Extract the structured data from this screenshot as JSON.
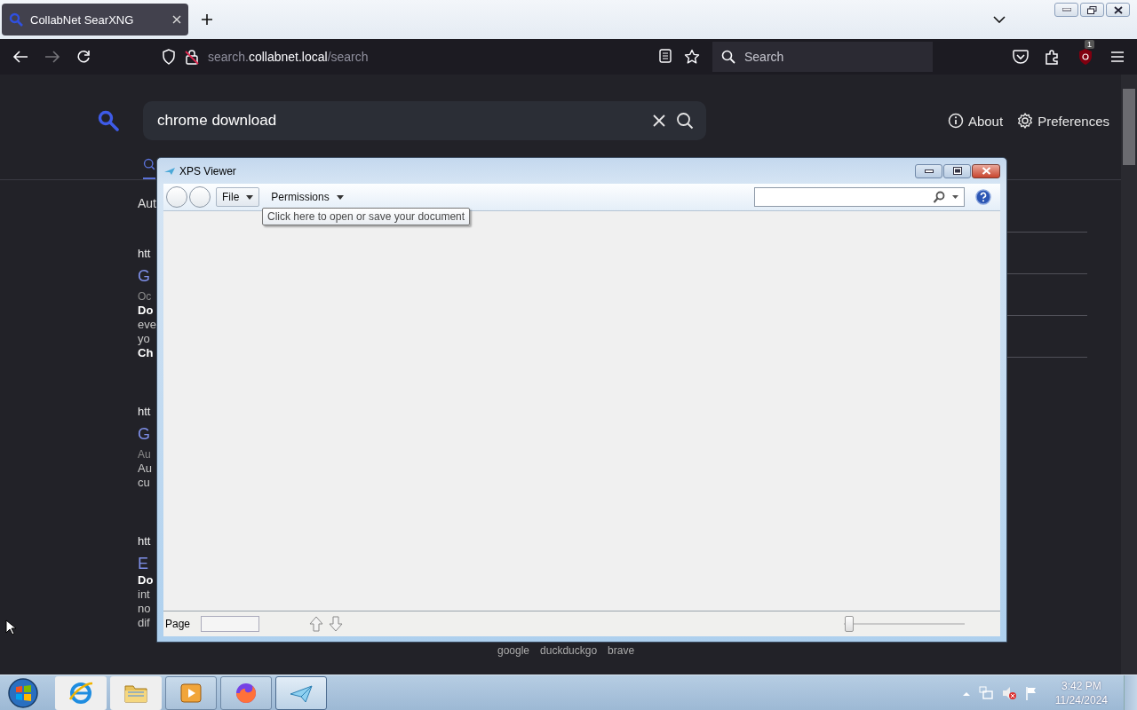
{
  "browser": {
    "tab": {
      "title": "CollabNet SearXNG",
      "selected": true
    },
    "url": {
      "subdomain": "search.",
      "domain": "collabnet.local",
      "path": "/search"
    },
    "forward_disabled": true,
    "search_placeholder": "Search",
    "extension_badge": "1"
  },
  "searxng": {
    "query": "chrome download",
    "links": [
      {
        "label": "About",
        "kind": "info"
      },
      {
        "label": "Preferences",
        "kind": "gear"
      }
    ],
    "result_count": "Aut",
    "results": [
      {
        "url": "htt",
        "title": "G",
        "meta": "Oc",
        "snippet": [
          {
            "text": "Do",
            "bold": true
          },
          {
            "text": "eve",
            "bold": false
          },
          {
            "text": "yo",
            "bold": false
          },
          {
            "text": "Ch",
            "bold": true
          }
        ]
      },
      {
        "url": "htt",
        "title": "G",
        "meta": "Au",
        "snippet": [
          {
            "text": "Au",
            "bold": false
          },
          {
            "text": "cu",
            "bold": false
          }
        ]
      },
      {
        "url": "htt",
        "title": "E",
        "snippet": [
          {
            "text": "Do",
            "bold": true
          },
          {
            "text": "int",
            "bold": false
          },
          {
            "text": "no",
            "bold": false
          },
          {
            "text": "dif",
            "bold": false
          }
        ]
      }
    ],
    "engines": [
      "google",
      "duckduckgo",
      "brave"
    ]
  },
  "xps_viewer": {
    "title": "XPS Viewer",
    "menus": [
      {
        "label": "File",
        "hovered": true
      },
      {
        "label": "Permissions",
        "hovered": false
      }
    ],
    "tooltip": "Click here to open or save your document",
    "status_bar": {
      "page_label": "Page",
      "zoom": {
        "level": 0.02
      }
    }
  },
  "taskbar": {
    "apps": [
      {
        "kind": "explorer",
        "running": false,
        "selected": false
      },
      {
        "kind": "folder",
        "running": false,
        "selected": false
      },
      {
        "kind": "player",
        "running": true,
        "selected": false
      },
      {
        "kind": "firefox",
        "running": true,
        "selected": false
      },
      {
        "kind": "viewer",
        "running": true,
        "selected": true
      }
    ],
    "clock": {
      "time": "3:42 PM",
      "date": "11/24/2024"
    }
  }
}
